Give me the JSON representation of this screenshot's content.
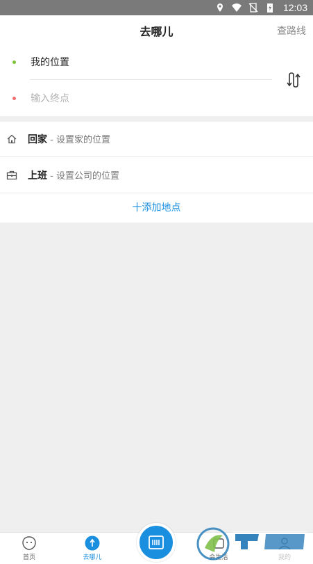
{
  "status_bar": {
    "time": "12:03",
    "icons": [
      "location-icon",
      "wifi-icon",
      "no-sim-icon",
      "battery-charging-icon"
    ]
  },
  "header": {
    "title": "去哪儿",
    "action": "查路线"
  },
  "route": {
    "start_label": "我的位置",
    "end_placeholder": "输入终点",
    "start_dot_color": "#7cc13b",
    "end_dot_color": "#ee6f6f",
    "swap_icon": "swap-route-icon"
  },
  "places": {
    "home": {
      "name": "回家",
      "hint": " - 设置家的位置",
      "icon": "home-icon"
    },
    "work": {
      "name": "上班",
      "hint": " - 设置公司的位置",
      "icon": "briefcase-icon"
    },
    "add_label": "十添加地点"
  },
  "bottom_nav": {
    "items": [
      {
        "label": "首页",
        "icon": "smiley-icon",
        "active": false
      },
      {
        "label": "去哪儿",
        "icon": "direction-icon",
        "active": true
      },
      {
        "label": "会生活",
        "icon": "life-icon",
        "active": false
      },
      {
        "label": "我的",
        "icon": "user-icon",
        "active": false
      }
    ],
    "center_icon": "scan-icon"
  },
  "colors": {
    "accent": "#1a8fe0",
    "background": "#efefef"
  }
}
